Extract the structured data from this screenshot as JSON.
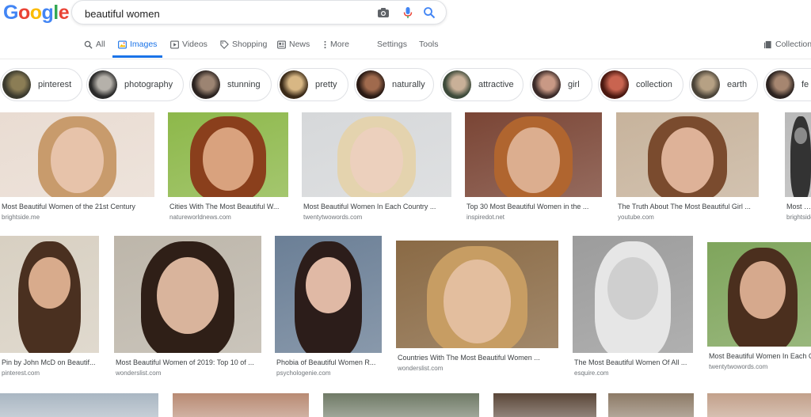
{
  "logo": [
    "G",
    "o",
    "o",
    "g",
    "l",
    "e"
  ],
  "logo_colors": [
    "#4285f4",
    "#ea4335",
    "#fbbc05",
    "#4285f4",
    "#34a853",
    "#ea4335"
  ],
  "search": {
    "value": "beautiful women",
    "icons": [
      "camera-icon",
      "microphone-icon",
      "search-icon"
    ]
  },
  "tabs": {
    "all": "All",
    "images": "Images",
    "videos": "Videos",
    "shopping": "Shopping",
    "news": "News",
    "more": "More",
    "settings": "Settings",
    "tools": "Tools",
    "collection": "Collection"
  },
  "chips": [
    "pinterest",
    "photography",
    "stunning",
    "pretty",
    "naturally",
    "attractive",
    "girl",
    "collection",
    "earth",
    "fe"
  ],
  "results": [
    {
      "title": "Most Beautiful Women of the 21st Century",
      "source": "brightside.me"
    },
    {
      "title": "Cities With The Most Beautiful W...",
      "source": "natureworldnews.com"
    },
    {
      "title": "Most Beautiful Women In Each Country ...",
      "source": "twentytwowords.com"
    },
    {
      "title": "Top 30 Most Beautiful Women in the ...",
      "source": "inspiredot.net"
    },
    {
      "title": "The Truth About The Most Beautiful Girl ...",
      "source": "youtube.com"
    },
    {
      "title": "Most Beaut",
      "source": "brightside.m"
    },
    {
      "title": "Pin by John McD on Beautif...",
      "source": "pinterest.com"
    },
    {
      "title": "Most Beautiful Women of 2019: Top 10 of ...",
      "source": "wonderslist.com"
    },
    {
      "title": "Phobia of Beautiful Women R...",
      "source": "psychologenie.com"
    },
    {
      "title": "Countries With The Most Beautiful Women ...",
      "source": "wonderslist.com"
    },
    {
      "title": "The Most Beautiful Women Of All ...",
      "source": "esquire.com"
    },
    {
      "title": "Most Beautiful Women In Each C",
      "source": "twentytwowords.com"
    }
  ],
  "colors": {
    "accent": "#1a73e8",
    "tab_text": "#5f6368",
    "source_text": "#70757a"
  }
}
